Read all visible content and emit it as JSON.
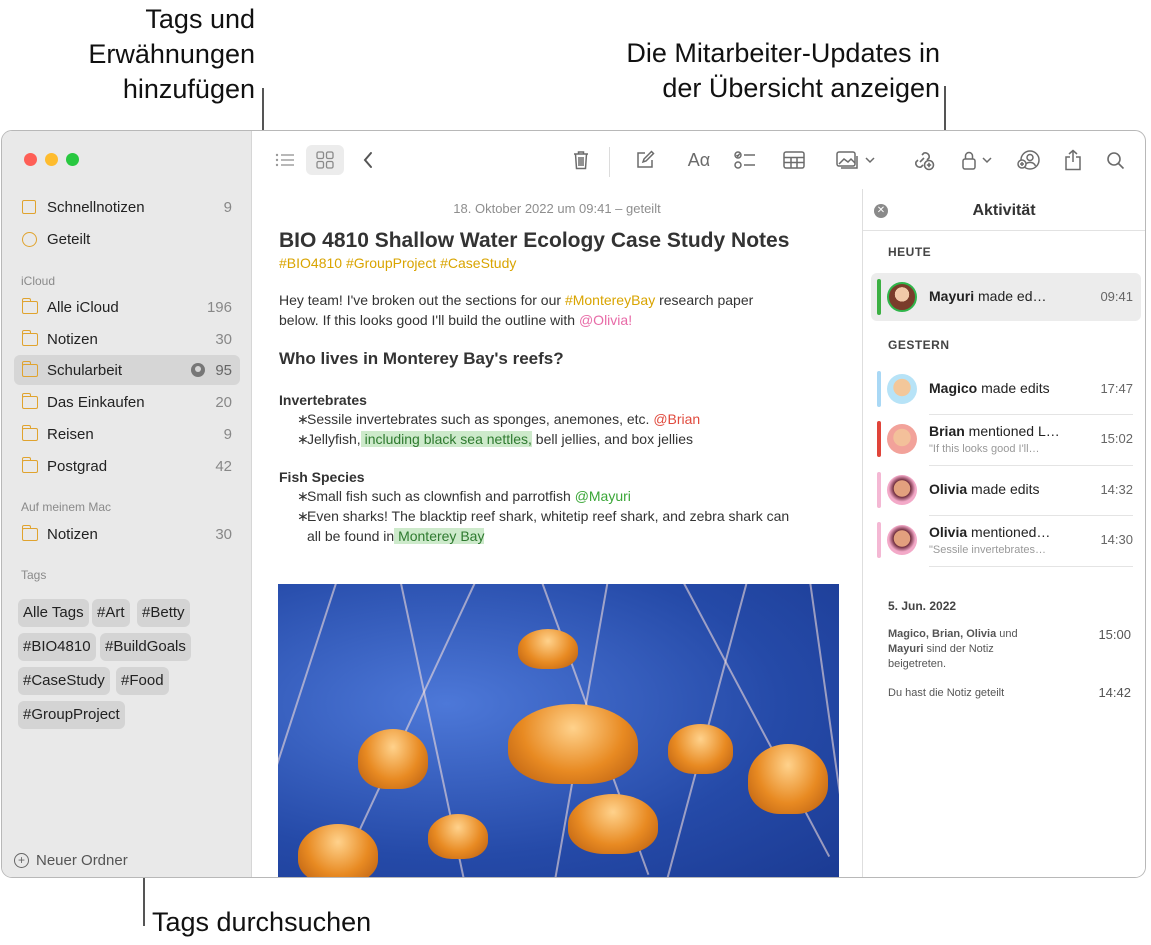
{
  "callouts": {
    "top_left_1": "Tags und",
    "top_left_2": "Erwähnungen",
    "top_left_3": "hinzufügen",
    "top_right_1": "Die Mitarbeiter-Updates in",
    "top_right_2": "der Übersicht anzeigen",
    "bottom": "Tags durchsuchen"
  },
  "sidebar": {
    "top_items": [
      {
        "label": "Schnellnotizen",
        "count": "9"
      },
      {
        "label": "Geteilt",
        "count": ""
      }
    ],
    "icloud_header": "iCloud",
    "icloud_items": [
      {
        "label": "Alle iCloud",
        "count": "196"
      },
      {
        "label": "Notizen",
        "count": "30"
      },
      {
        "label": "Schularbeit",
        "count": "95"
      },
      {
        "label": "Das Einkaufen",
        "count": "20"
      },
      {
        "label": "Reisen",
        "count": "9"
      },
      {
        "label": "Postgrad",
        "count": "42"
      }
    ],
    "mac_header": "Auf meinem Mac",
    "mac_items": [
      {
        "label": "Notizen",
        "count": "30"
      }
    ],
    "tags_header": "Tags",
    "tags": [
      "Alle Tags",
      "#Art",
      "#Betty",
      "#BIO4810",
      "#BuildGoals",
      "#CaseStudy",
      "#Food",
      "#GroupProject"
    ],
    "new_folder": "Neuer Ordner"
  },
  "toolbar": {
    "format_label": "Aα"
  },
  "note": {
    "date": "18. Oktober 2022 um 09:41 – geteilt",
    "title": "BIO 4810 Shallow Water Ecology Case Study Notes",
    "tags": "#BIO4810 #GroupProject #CaseStudy",
    "intro_1a": "Hey team! I've broken out the sections for our ",
    "intro_1tag": "#MontereyBay",
    "intro_1b": " research paper",
    "intro_2a": "below. If this looks good I'll build the outline with ",
    "intro_2mention": "@Olivia!",
    "heading": "Who lives in Monterey Bay's reefs?",
    "sub1": "Invertebrates",
    "b1a": "Sessile invertebrates such as sponges, anemones, etc. ",
    "b1m": "@Brian",
    "b2a": "Jellyfish,",
    "b2hl": " including black sea nettles,",
    "b2b": " bell jellies, and box jellies",
    "sub2": "Fish Species",
    "b3a": "Small fish such as clownfish and parrotfish ",
    "b3m": "@Mayuri",
    "b4a": "Even sharks! The blacktip reef shark, whitetip reef shark, and zebra shark can",
    "b4b": "all be found in",
    "b4hl": " Monterey Bay"
  },
  "activity": {
    "title": "Aktivität",
    "today": "HEUTE",
    "yesterday": "GESTERN",
    "items": [
      {
        "name": "Mayuri",
        "action": " made ed…",
        "sub": "",
        "time": "09:41",
        "bar": "#3cb043"
      },
      {
        "name": "Magico",
        "action": " made edits",
        "sub": "",
        "time": "17:47",
        "bar": "#a9d8f5"
      },
      {
        "name": "Brian",
        "action": " mentioned L…",
        "sub": "\"If this looks good I'll…",
        "time": "15:02",
        "bar": "#e0443a"
      },
      {
        "name": "Olivia",
        "action": " made edits",
        "sub": "",
        "time": "14:32",
        "bar": "#f4b8d4"
      },
      {
        "name": "Olivia",
        "action": " mentioned…",
        "sub": "\"Sessile invertebrates…",
        "time": "14:30",
        "bar": "#f4b8d4"
      }
    ],
    "date3": "5. Jun. 2022",
    "hist1_names": "Magico, Brian, Olivia",
    "hist1_und": " und",
    "hist1_name2": "Mayuri",
    "hist1_rest": " sind der Notiz",
    "hist1_rest2": "beigetreten.",
    "hist1_time": "15:00",
    "hist2": "Du hast die Notiz geteilt",
    "hist2_time": "14:42"
  },
  "colors": {
    "tag": "#d9a400",
    "mention_red": "#e04a3d",
    "mention_pink": "#e86aa7",
    "mention_green": "#3aa637",
    "highlight": "#cdeacb",
    "folder": "#e0a32e"
  }
}
